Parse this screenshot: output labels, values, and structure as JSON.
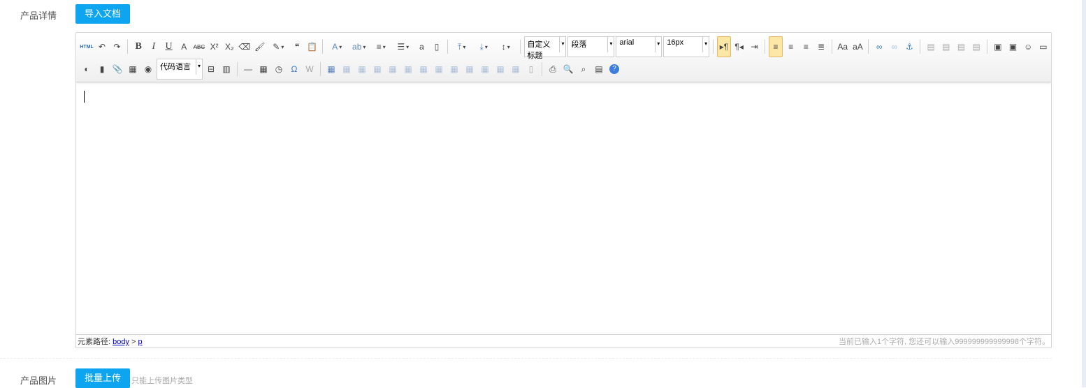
{
  "detail": {
    "label": "产品详情",
    "import_button": "导入文档"
  },
  "toolbar": {
    "row1": [
      "html-source",
      "undo",
      "redo",
      "|",
      "bold",
      "italic",
      "underline",
      "font-border",
      "strikethrough",
      "superscript",
      "subscript",
      "remove-format",
      "format-match",
      "auto-typeset*",
      "blockquote",
      "paste-plain",
      "|",
      "fore-color*",
      "back-color*",
      "ordered-list*",
      "unordered-list*",
      "select-all",
      "clear-doc",
      "|",
      "row-spacing-top*",
      "row-spacing-bottom*",
      "line-height*",
      "|",
      "S0",
      "S1",
      "S2",
      "S3",
      "|",
      "direction-ltr!",
      "direction-rtl",
      "indent",
      "|",
      "justify-left!",
      "justify-center",
      "justify-right",
      "justify-full",
      "|",
      "to-uppercase",
      "to-lowercase",
      "|",
      "link",
      "unlink~",
      "anchor",
      "|",
      "image-none~",
      "image-left~",
      "image-right~",
      "image-center~",
      "|",
      "simple-upload",
      "insert-image",
      "emotion",
      "scrawl"
    ],
    "row2": [
      "insert-frame",
      "insert-video",
      "attachment",
      "map",
      "google-map",
      "S4",
      "page-break",
      "template",
      "|",
      "horizontal-rule",
      "date",
      "time",
      "special-chars",
      "word-image~",
      "|",
      "insert-table",
      "delete-table~",
      "insert-paragraph-before-table~",
      "insert-row~",
      "delete-row~",
      "insert-col~",
      "delete-col~",
      "merge-cells~",
      "merge-right~",
      "merge-down~",
      "split-to-cells~",
      "split-to-rows~",
      "split-to-cols~",
      "charts~",
      "|",
      "print",
      "preview",
      "search-replace",
      "drafts",
      "help"
    ],
    "selects": [
      "自定义标题",
      "段落",
      "arial",
      "16px",
      "代码语言"
    ],
    "glyphs": {
      "html-source": "HTML",
      "undo": "↶",
      "redo": "↷",
      "bold": "B",
      "italic": "I",
      "underline": "U",
      "font-border": "A",
      "strikethrough": "ABC",
      "superscript": "X²",
      "subscript": "X₂",
      "remove-format": "⌫",
      "format-match": "🖌",
      "auto-typeset": "✎",
      "blockquote": "❝",
      "paste-plain": "📋",
      "fore-color": "A",
      "back-color": "ab",
      "ordered-list": "≡",
      "unordered-list": "☰",
      "select-all": "a",
      "clear-doc": "▯",
      "row-spacing-top": "⤒",
      "row-spacing-bottom": "⤓",
      "line-height": "↕",
      "direction-ltr": "▸¶",
      "direction-rtl": "¶◂",
      "indent": "⇥",
      "justify-left": "≡",
      "justify-center": "≡",
      "justify-right": "≡",
      "justify-full": "≣",
      "to-uppercase": "Aa",
      "to-lowercase": "aA",
      "link": "∞",
      "unlink": "∞",
      "anchor": "⚓",
      "image-none": "▤",
      "image-left": "▤",
      "image-right": "▤",
      "image-center": "▤",
      "simple-upload": "▣",
      "insert-image": "▣",
      "emotion": "☺",
      "scrawl": "▭",
      "insert-frame": "◐",
      "insert-video": "▮",
      "attachment": "📎",
      "map": "▦",
      "google-map": "◉",
      "page-break": "⊟",
      "template": "▥",
      "horizontal-rule": "—",
      "date": "▦",
      "time": "◷",
      "special-chars": "Ω",
      "word-image": "W",
      "insert-table": "▦",
      "delete-table": "▦",
      "insert-paragraph-before-table": "▦",
      "insert-row": "▦",
      "delete-row": "▦",
      "insert-col": "▦",
      "delete-col": "▦",
      "merge-cells": "▦",
      "merge-right": "▦",
      "merge-down": "▦",
      "split-to-cells": "▦",
      "split-to-rows": "▦",
      "split-to-cols": "▦",
      "charts": "▯",
      "print": "⎙",
      "preview": "🔍",
      "search-replace": "⌕",
      "drafts": "▤",
      "help": "?"
    }
  },
  "footer": {
    "path_label": "元素路径: ",
    "path_body": "body",
    "path_sep": " > ",
    "path_p": "p",
    "count": "当前已输入1个字符, 您还可以输入999999999999998个字符。"
  },
  "images": {
    "label": "产品图片",
    "upload_button": "批量上传",
    "hint": "只能上传图片类型"
  }
}
